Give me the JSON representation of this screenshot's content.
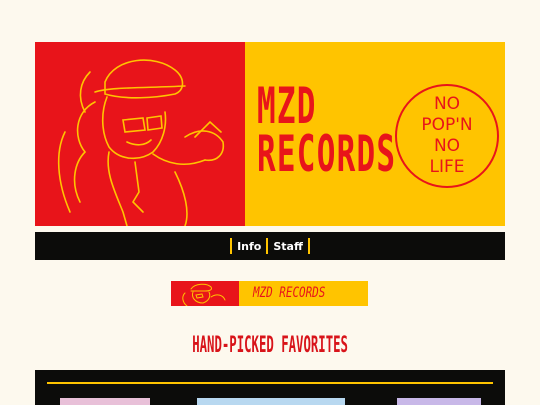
{
  "banner": {
    "title_line1": "MZD",
    "title_line2": "RECORDS",
    "badge_lines": [
      "NO",
      "POP'N",
      "NO",
      "LIFE"
    ]
  },
  "nav": {
    "items": [
      {
        "label": "Info"
      },
      {
        "label": "Staff"
      }
    ]
  },
  "mini_banner": {
    "title": "MZD RECORDS"
  },
  "section": {
    "title": "HAND-PICKED FAVORITES"
  },
  "colors": {
    "red": "#e8141a",
    "yellow": "#ffc400",
    "dark": "#0c0c0a",
    "page": "#fdf9ee"
  }
}
